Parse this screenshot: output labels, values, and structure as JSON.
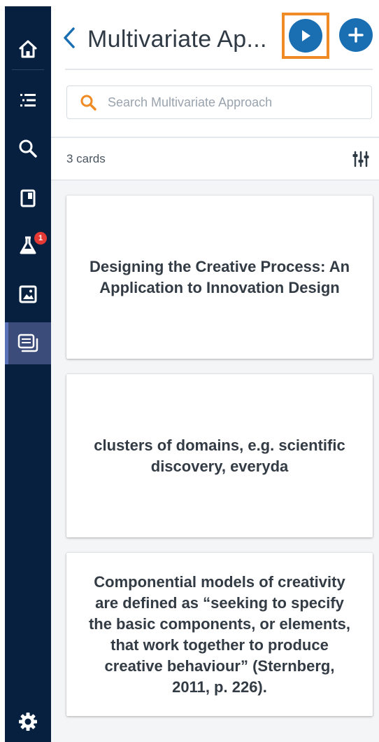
{
  "header": {
    "title": "Multivariate Ap...",
    "play_label": "Play",
    "add_label": "Add"
  },
  "sidebar": {
    "items": [
      {
        "name": "home-icon"
      },
      {
        "name": "list-icon"
      },
      {
        "name": "search-icon"
      },
      {
        "name": "door-icon"
      },
      {
        "name": "flask-icon",
        "badge": "1"
      },
      {
        "name": "image-icon"
      },
      {
        "name": "cards-icon"
      },
      {
        "name": "settings-icon"
      }
    ]
  },
  "search": {
    "placeholder": "Search Multivariate Approach",
    "value": ""
  },
  "toolbar": {
    "count_label": "3 cards"
  },
  "cards": [
    {
      "text": "Designing the Creative Process: An Application to Innovation Design"
    },
    {
      "text": "clusters of domains, e.g. scientific discovery, everyda"
    },
    {
      "text": "Componential models of creativity are defined as “seeking to specify the basic components, or elements, that work together to produce creative behaviour” (Sternberg, 2011, p. 226)."
    }
  ],
  "colors": {
    "sidebar_bg": "#07203f",
    "accent_blue": "#1a6fb3",
    "highlight_orange": "#f08a24",
    "badge_red": "#e53935"
  }
}
